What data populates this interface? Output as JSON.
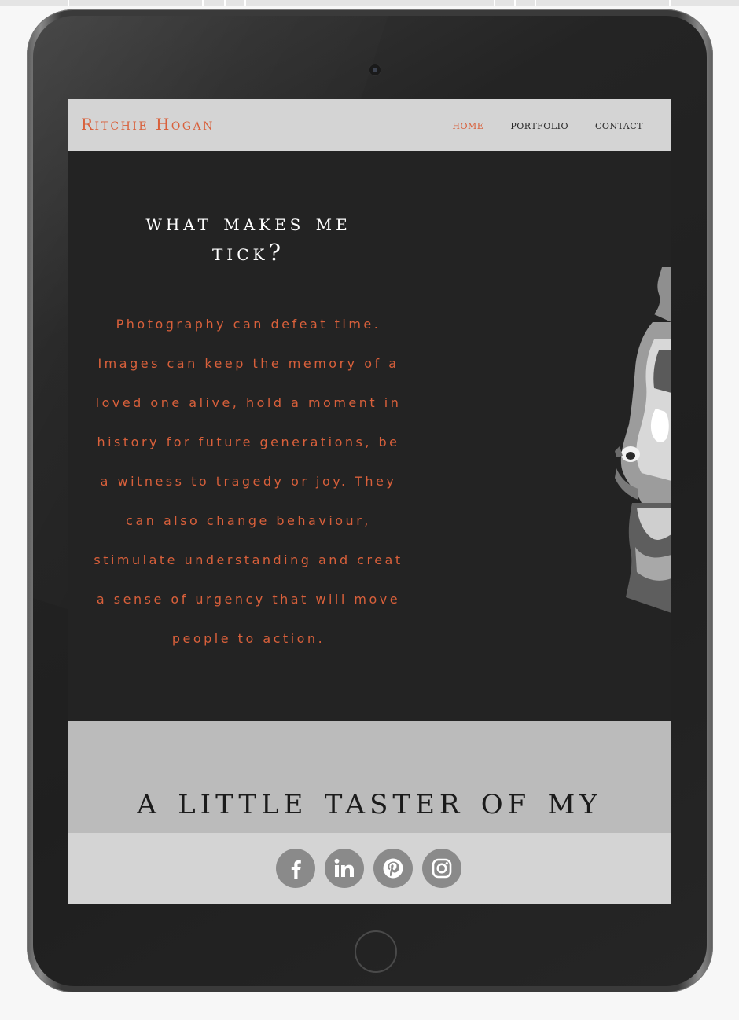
{
  "site": {
    "brand": "Ritchie Hogan"
  },
  "nav": {
    "items": [
      {
        "label": "HOME",
        "active": true
      },
      {
        "label": "PORTFOLIO",
        "active": false
      },
      {
        "label": "CONTACT",
        "active": false
      }
    ]
  },
  "about": {
    "title": "WHAT MAKES ME TICK?",
    "body": "Photography can defeat time. Images can keep the memory of a loved one alive, hold a moment in history for future generations, be a witness to tragedy or joy. They can also change behaviour, stimulate understanding and creat a sense of urgency that will move people to action."
  },
  "gallery": {
    "title": "A LITTLE TASTER OF MY"
  },
  "social": {
    "icons": [
      "facebook-icon",
      "linkedin-icon",
      "pinterest-icon",
      "instagram-icon"
    ]
  },
  "colors": {
    "accent": "#d9603b",
    "screen_dark": "#232323",
    "nav_bg": "#d4d4d4",
    "section_grey": "#bbbbbb",
    "social_circle": "#8a8a8a"
  }
}
